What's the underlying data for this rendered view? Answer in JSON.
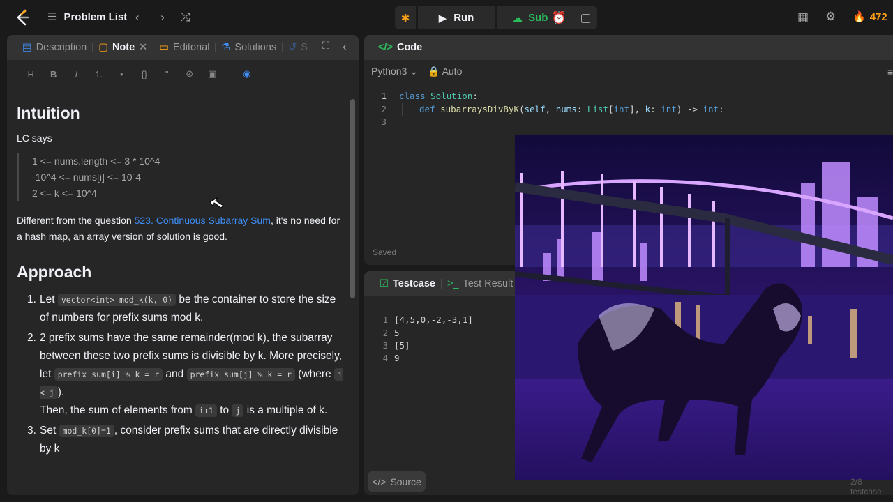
{
  "topbar": {
    "problem_list": "Problem List",
    "run": "Run",
    "submit": "Submit",
    "streak": "472"
  },
  "left_tabs": {
    "description": "Description",
    "note": "Note",
    "editorial": "Editorial",
    "solutions": "Solutions",
    "submissions": "S"
  },
  "toolbar": {
    "heading": "H",
    "bold": "B",
    "italic": "I",
    "ol": "1.",
    "ul": "•",
    "code": "{}",
    "quote": "''",
    "link": "⊘",
    "image": "▣",
    "preview": "◉"
  },
  "note": {
    "intuition_title": "Intuition",
    "lc_says": "LC says",
    "constraints": [
      "1 <= nums.length <= 3 * 10^4",
      "-10^4 <= nums[i] <= 10´4",
      "2 <= k <= 10^4"
    ],
    "diff_pre": "Different from the question ",
    "diff_link": "523. Continuous Subarray Sum",
    "diff_post": ", it's no need for a hash map, an array version of solution is good.",
    "approach_title": "Approach",
    "s1_num": "1.",
    "s1_a": "Let ",
    "s1_code": "vector<int> mod_k(k, 0)",
    "s1_b": " be the container to store the size of numbers for prefix sums mod k.",
    "s2_num": "2.",
    "s2_a": "2 prefix sums have the same remainder(mod k), the subarray between these two prefix sums is divisible by k. More precisely, let ",
    "s2_code1": "prefix_sum[i] % k = r",
    "s2_b": " and ",
    "s2_code2": "prefix_sum[j] % k = r",
    "s2_c": " (where ",
    "s2_code3": "i < j",
    "s2_d": ").",
    "s2_e": "Then, the sum of elements from ",
    "s2_code4": "i+1",
    "s2_f": " to ",
    "s2_code5": "j",
    "s2_g": " is a multiple of k.",
    "s3_num": "3.",
    "s3_a": "Set ",
    "s3_code": "mod_k[0]=1",
    "s3_b": ", consider prefix sums that are directly divisible by k"
  },
  "code_panel": {
    "title": "Code",
    "language": "Python3",
    "auto": "Auto",
    "saved": "Saved",
    "lines": [
      "1",
      "2",
      "3"
    ],
    "l1_kw": "class ",
    "l1_cls": "Solution",
    ":": ":",
    "l2_kw": "def ",
    "l2_fn": "subarraysDivByK",
    "l2_a": "(",
    "l2_self": "self",
    ", ": ", ",
    "l2_nums": "nums",
    ": ": ": ",
    "l2_list": "List",
    "l2_b": "[",
    "l2_int1": "int",
    "l2_c": "], ",
    "l2_k": "k",
    "l2_int2": "int",
    "l2_d": ") -> ",
    "l2_int3": "int",
    "l2_e": ":"
  },
  "test_panel": {
    "testcase": "Testcase",
    "result": "Test Result",
    "lines": [
      "1",
      "2",
      "3",
      "4"
    ],
    "values": [
      "[4,5,0,-2,-3,1]",
      "5",
      "[5]",
      "9"
    ],
    "source": "Source",
    "cases": "2/8 testcase"
  }
}
